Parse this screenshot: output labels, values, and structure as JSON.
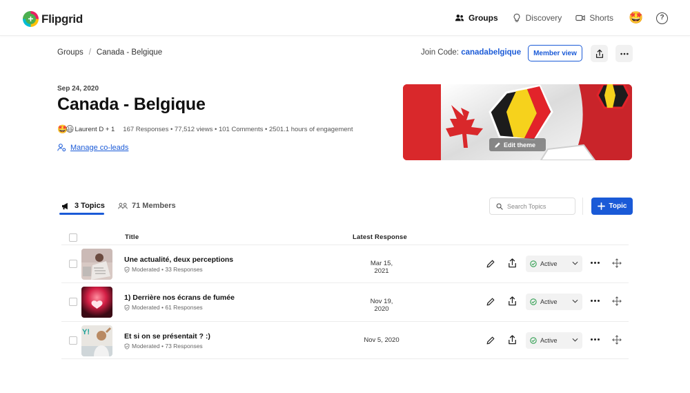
{
  "app": {
    "name": "Flipgrid"
  },
  "nav": {
    "groups": "Groups",
    "discovery": "Discovery",
    "shorts": "Shorts",
    "avatar_emoji": "🤩",
    "help": "?"
  },
  "breadcrumb": {
    "root": "Groups",
    "separator": "/",
    "current": "Canada - Belgique"
  },
  "join": {
    "label": "Join Code:",
    "code": "canadabelgique"
  },
  "actions": {
    "member_view": "Member view"
  },
  "group": {
    "date": "Sep 24, 2020",
    "title": "Canada - Belgique",
    "avatars": "🤩😃",
    "leads": "Laurent D + 1",
    "stats": "167 Responses • 77,512 views • 101 Comments • 2501.1 hours of engagement",
    "manage_coleads": "Manage co-leads",
    "edit_theme": "Edit theme"
  },
  "tabs": {
    "topics": "3 Topics",
    "members": "71 Members"
  },
  "search": {
    "placeholder": "Search Topics"
  },
  "add_topic": "Topic",
  "table": {
    "col_title": "Title",
    "col_latest": "Latest Response",
    "rows": [
      {
        "title": "Une actualité, deux perceptions",
        "meta": "Moderated • 33 Responses",
        "date": "Mar 15, 2021",
        "status": "Active"
      },
      {
        "title": "1) Derrière nos écrans de fumée",
        "meta": "Moderated • 61 Responses",
        "date": "Nov 19, 2020",
        "status": "Active"
      },
      {
        "title": "Et si on se présentait ? :)",
        "meta": "Moderated • 73 Responses",
        "date": "Nov 5, 2020",
        "status": "Active"
      }
    ]
  },
  "colors": {
    "accent": "#1a5ad7",
    "flag_red": "#d9282b",
    "belgium_yellow": "#f6d21c",
    "active_green": "#2e9e4f"
  }
}
